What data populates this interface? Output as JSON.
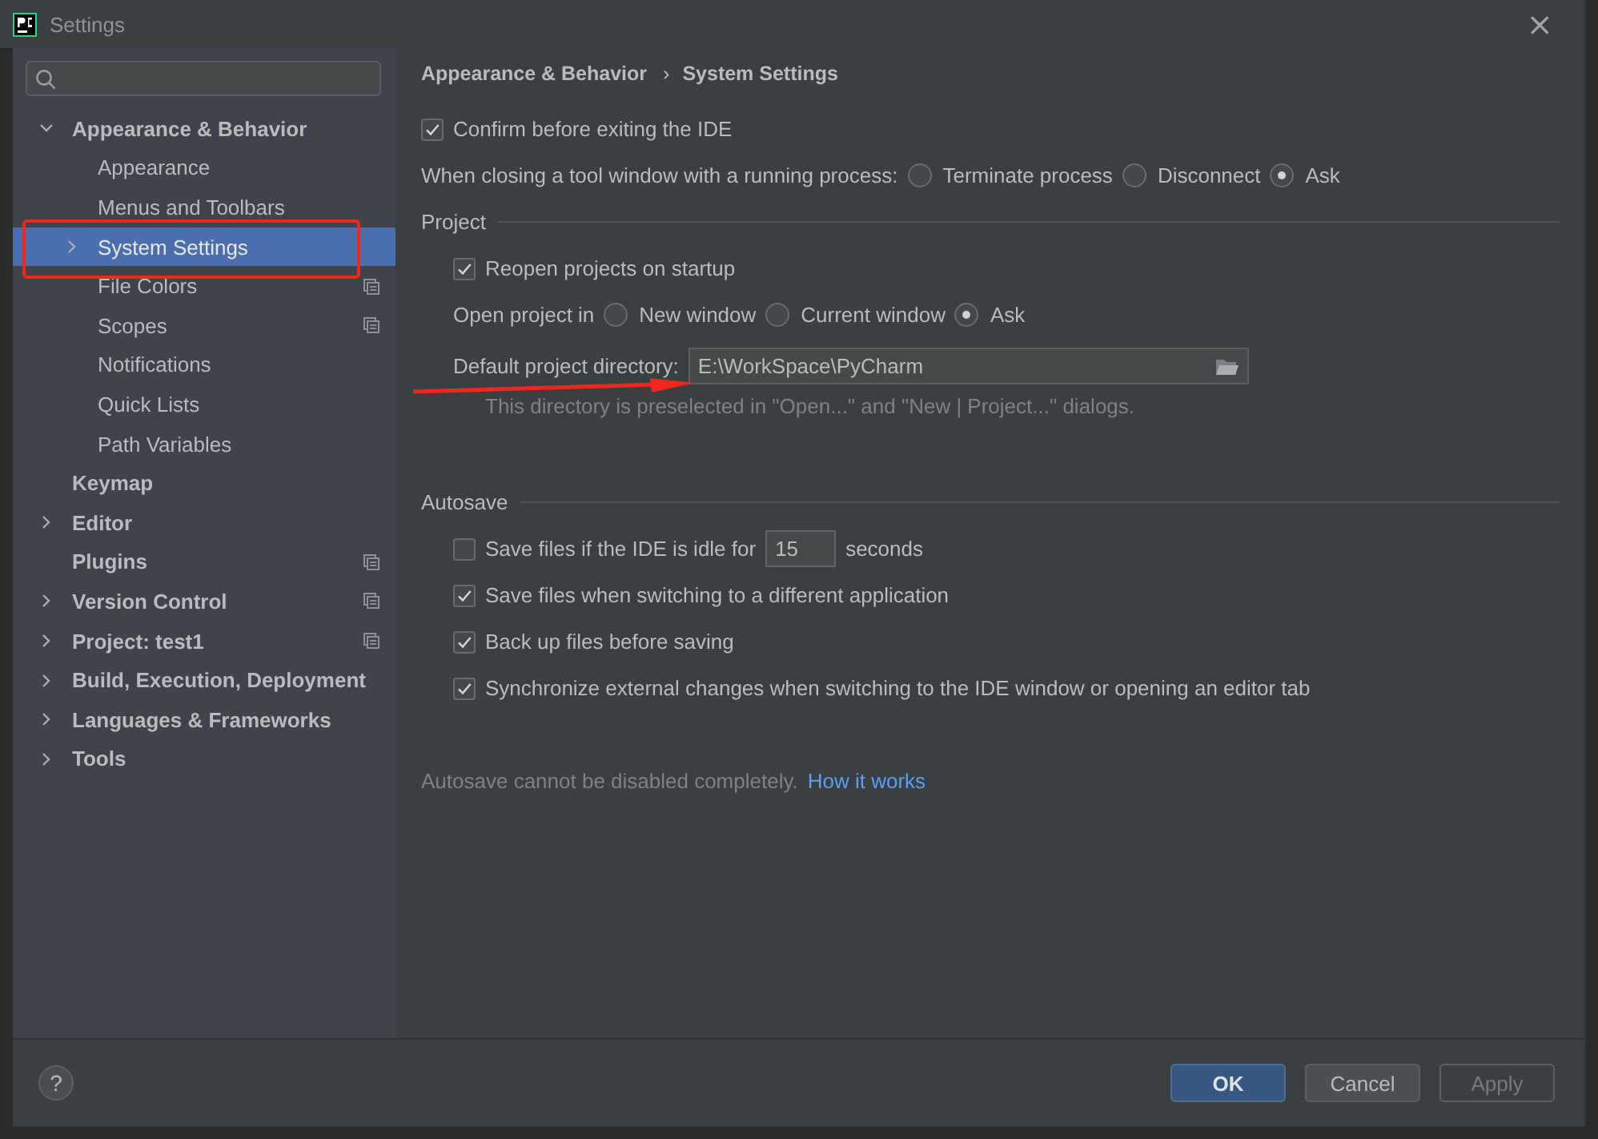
{
  "window": {
    "title": "Settings",
    "close": "×"
  },
  "sidebar": {
    "items": [
      {
        "label": "Appearance & Behavior",
        "expanded": true,
        "selected": false,
        "shared": false,
        "children": [
          {
            "label": "Appearance",
            "selected": false,
            "shared": false
          },
          {
            "label": "Menus and Toolbars",
            "selected": false,
            "shared": false
          },
          {
            "label": "System Settings",
            "expanded": false,
            "selected": true,
            "shared": false
          },
          {
            "label": "File Colors",
            "selected": false,
            "shared": true
          },
          {
            "label": "Scopes",
            "selected": false,
            "shared": true
          },
          {
            "label": "Notifications",
            "selected": false,
            "shared": false
          },
          {
            "label": "Quick Lists",
            "selected": false,
            "shared": false
          },
          {
            "label": "Path Variables",
            "selected": false,
            "shared": false
          }
        ]
      },
      {
        "label": "Keymap",
        "selected": false,
        "shared": false
      },
      {
        "label": "Editor",
        "expanded": false,
        "selected": false,
        "shared": false
      },
      {
        "label": "Plugins",
        "selected": false,
        "shared": true
      },
      {
        "label": "Version Control",
        "expanded": false,
        "selected": false,
        "shared": true
      },
      {
        "label": "Project: test1",
        "expanded": false,
        "selected": false,
        "shared": true
      },
      {
        "label": "Build, Execution, Deployment",
        "expanded": false,
        "selected": false,
        "shared": false
      },
      {
        "label": "Languages & Frameworks",
        "expanded": false,
        "selected": false,
        "shared": false
      },
      {
        "label": "Tools",
        "expanded": false,
        "selected": false,
        "shared": false
      }
    ]
  },
  "breadcrumb": [
    "Appearance & Behavior",
    "System Settings"
  ],
  "breadcrumb_separator": "›",
  "confirm_exit": {
    "label": "Confirm before exiting the IDE",
    "checked": true
  },
  "closing_tool_window": {
    "label": "When closing a tool window with a running process:",
    "options": [
      {
        "label": "Terminate process",
        "selected": false
      },
      {
        "label": "Disconnect",
        "selected": false
      },
      {
        "label": "Ask",
        "selected": true
      }
    ]
  },
  "project": {
    "title": "Project",
    "reopen": {
      "label": "Reopen projects on startup",
      "checked": true
    },
    "open_in": {
      "label": "Open project in",
      "options": [
        {
          "label": "New window",
          "selected": false
        },
        {
          "label": "Current window",
          "selected": false
        },
        {
          "label": "Ask",
          "selected": true
        }
      ]
    },
    "directory": {
      "label": "Default project directory:",
      "value": "E:\\WorkSpace\\PyCharm",
      "hint": "This directory is preselected in \"Open...\" and \"New | Project...\" dialogs."
    }
  },
  "autosave": {
    "title": "Autosave",
    "idle": {
      "label": "Save files if the IDE is idle for",
      "value": "15",
      "unit": "seconds",
      "checked": false
    },
    "options": [
      {
        "label": "Save files when switching to a different application",
        "checked": true
      },
      {
        "label": "Back up files before saving",
        "checked": true
      },
      {
        "label": "Synchronize external changes when switching to the IDE window or opening an editor tab",
        "checked": true
      }
    ],
    "note": "Autosave cannot be disabled completely.",
    "link": "How it works"
  },
  "help": "?",
  "buttons": [
    {
      "label": "OK",
      "kind": "primary"
    },
    {
      "label": "Cancel",
      "kind": "normal"
    },
    {
      "label": "Apply",
      "kind": "disabled"
    }
  ]
}
